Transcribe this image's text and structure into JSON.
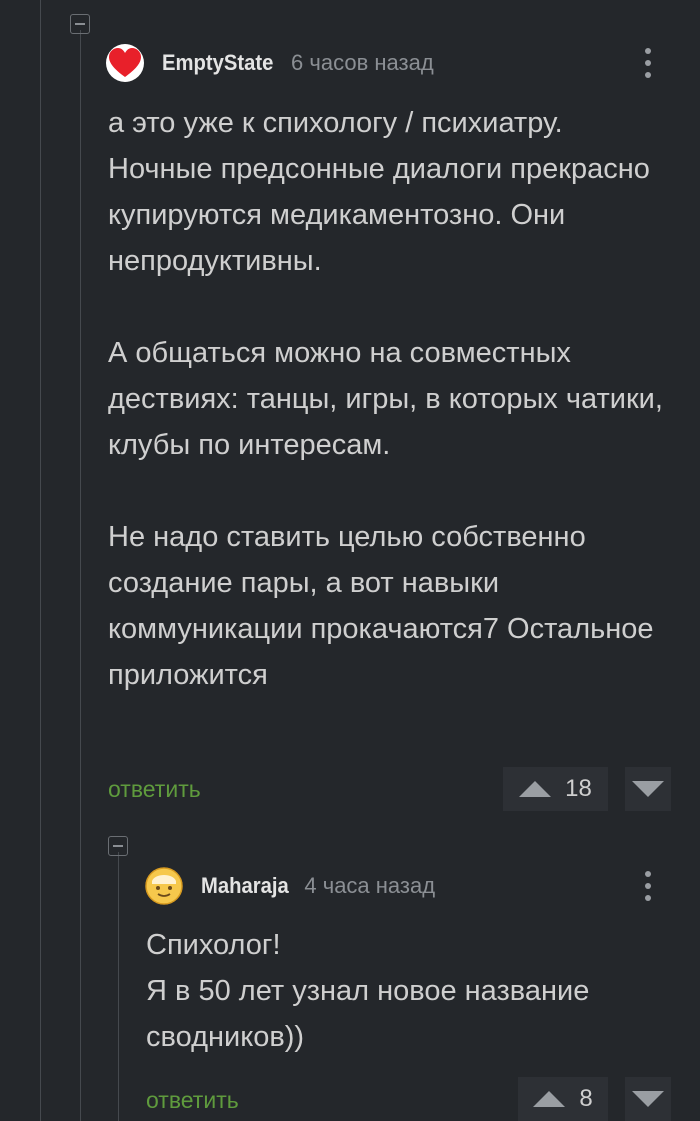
{
  "comments": [
    {
      "author": "EmptyState",
      "time": "6 часов назад",
      "text": "а это уже к спихологу / психиатру. Ночные предсонные диалоги прекрасно купируются медикаментозно. Они непродуктивны.\n\nА общаться можно на совместных дествиях: танцы, игры, в которых чатики, клубы по интересам.\n\nНе надо ставить целью собственно создание пары, а вот навыки коммуникации прокачаются7 Остальное приложится",
      "reply_label": "ответить",
      "rating": "18"
    },
    {
      "author": "Maharaja",
      "time": "4 часа назад",
      "text": "Спихолог!\nЯ в 50 лет узнал новое название сводников))",
      "reply_label": "ответить",
      "rating": "8"
    }
  ],
  "colors": {
    "background": "#24272b",
    "reply_link": "#5f9b3d",
    "vote_box": "#2d3035",
    "avatar_heart": "#e8202a"
  },
  "icons": [
    "heart-avatar",
    "emoji-avatar",
    "collapse-icon",
    "more-icon",
    "upvote-icon",
    "downvote-icon"
  ]
}
